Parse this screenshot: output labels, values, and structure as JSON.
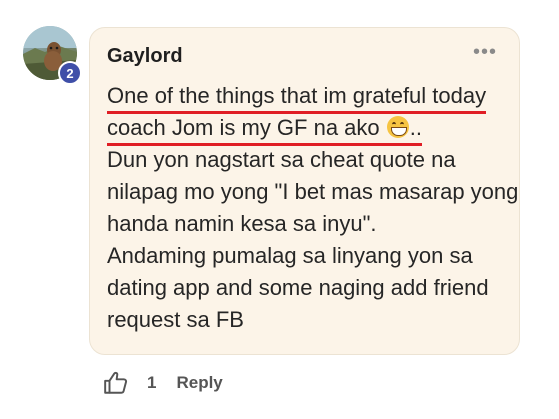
{
  "avatar": {
    "badge": "2"
  },
  "comment": {
    "author": "Gaylord",
    "more_icon": "more-horizontal-icon",
    "lines": [
      "One of the things that im grateful today",
      "coach Jom is my GF na ako",
      "..",
      "Dun yon nagstart sa cheat quote na",
      "nilapag mo yong \"I bet mas masarap yong",
      "handa namin kesa sa inyu\".",
      "Andaming pumalag sa linyang yon sa",
      "dating app and some naging add friend",
      "request sa FB"
    ],
    "emoji": "grinning-face-emoji"
  },
  "actions": {
    "like_icon": "thumbs-up-icon",
    "like_count": "1",
    "reply_label": "Reply"
  },
  "colors": {
    "bubble_bg": "#fcf4e8",
    "underline": "#e01e25",
    "badge_bg": "#3f4fa8"
  }
}
